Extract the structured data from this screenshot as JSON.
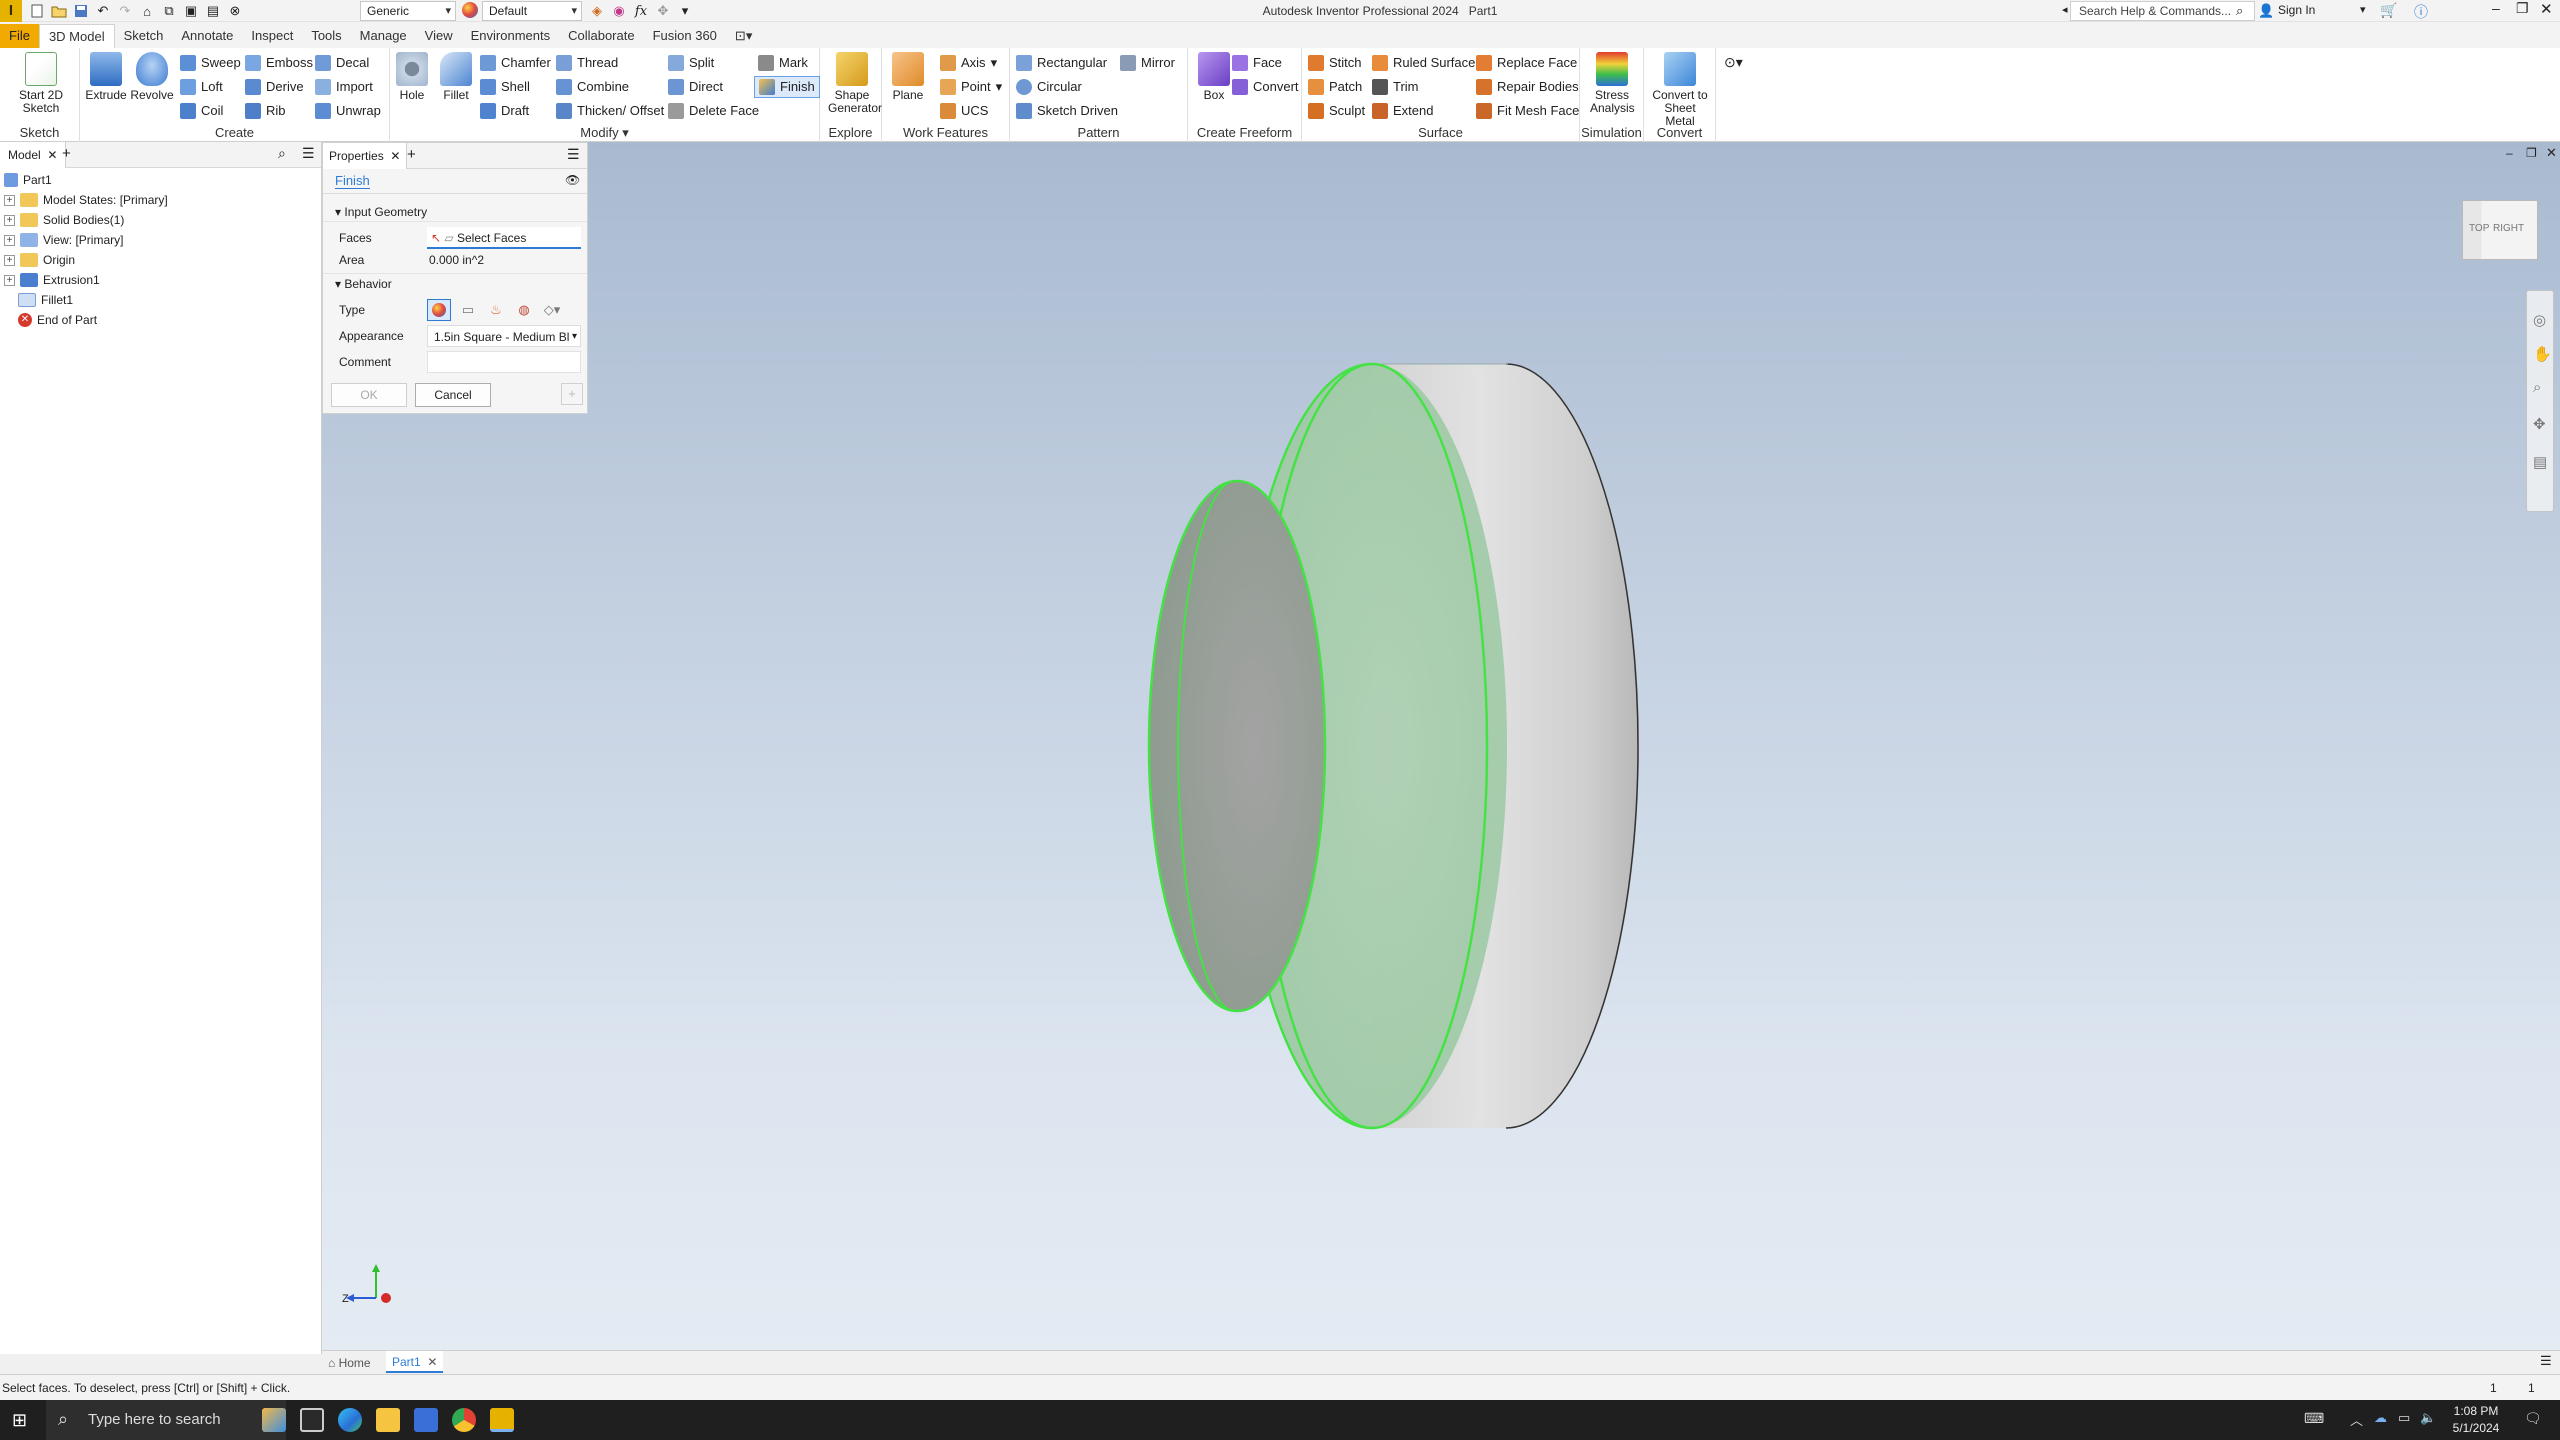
{
  "window": {
    "app_title": "Autodesk Inventor Professional 2024",
    "doc_title": "Part1"
  },
  "quick_access": {
    "material_select": "Generic",
    "appearance_select": "Default"
  },
  "menu_tabs": [
    "File",
    "3D Model",
    "Sketch",
    "Annotate",
    "Inspect",
    "Tools",
    "Manage",
    "View",
    "Environments",
    "Collaborate",
    "Fusion 360"
  ],
  "search": {
    "placeholder": "Search Help & Commands..."
  },
  "account": {
    "sign_in": "Sign In"
  },
  "ribbon": {
    "panels": [
      "Sketch",
      "Create",
      "Modify",
      "Explore",
      "Work Features",
      "Pattern",
      "Create Freeform",
      "Surface",
      "Simulation",
      "Convert"
    ],
    "start_sketch": "Start 2D Sketch",
    "extrude": "Extrude",
    "revolve": "Revolve",
    "sweep": "Sweep",
    "emboss": "Emboss",
    "decal": "Decal",
    "loft": "Loft",
    "derive": "Derive",
    "import": "Import",
    "coil": "Coil",
    "rib": "Rib",
    "unwrap": "Unwrap",
    "hole": "Hole",
    "fillet": "Fillet",
    "chamfer": "Chamfer",
    "thread": "Thread",
    "split": "Split",
    "mark": "Mark",
    "shell": "Shell",
    "combine": "Combine",
    "direct": "Direct",
    "finish": "Finish",
    "draft": "Draft",
    "thicken": "Thicken/ Offset",
    "delete_face": "Delete Face",
    "shape_generator": "Shape Generator",
    "plane": "Plane",
    "axis": "Axis",
    "point": "Point",
    "ucs": "UCS",
    "rectangular": "Rectangular",
    "mirror": "Mirror",
    "circular": "Circular",
    "sketch_driven": "Sketch Driven",
    "box": "Box",
    "face": "Face",
    "convert": "Convert",
    "stitch": "Stitch",
    "ruled_surface": "Ruled Surface",
    "replace_face": "Replace Face",
    "patch": "Patch",
    "trim": "Trim",
    "repair_bodies": "Repair Bodies",
    "sculpt": "Sculpt",
    "extend": "Extend",
    "fit_mesh_face": "Fit Mesh Face",
    "stress_analysis": "Stress Analysis",
    "convert_sheet_metal": "Convert to Sheet Metal"
  },
  "browser": {
    "tab": "Model",
    "items": [
      "Part1",
      "Model States: [Primary]",
      "Solid Bodies(1)",
      "View: [Primary]",
      "Origin",
      "Extrusion1",
      "Fillet1",
      "End of Part"
    ]
  },
  "properties": {
    "tab": "Properties",
    "command": "Finish",
    "input_geometry": "Input Geometry",
    "faces_label": "Faces",
    "faces_value": "Select Faces",
    "area_label": "Area",
    "area_value": "0.000 in^2",
    "behavior": "Behavior",
    "type_label": "Type",
    "appearance_label": "Appearance",
    "appearance_value": "1.5in Square - Medium Bl",
    "comment_label": "Comment",
    "ok": "OK",
    "cancel": "Cancel"
  },
  "viewcube": {
    "top": "TOP",
    "right": "RIGHT"
  },
  "doc_tabs": {
    "home": "Home",
    "part": "Part1"
  },
  "status": {
    "message": "Select faces. To deselect, press [Ctrl] or [Shift] + Click.",
    "count1": "1",
    "count2": "1"
  },
  "taskbar": {
    "search": "Type here to search",
    "time": "1:08 PM",
    "date": "5/1/2024"
  },
  "colors": {
    "file_tab": "#f2a900",
    "selection_green": "#3ddc3d",
    "ribbon_accent": "#2e7bd6"
  }
}
